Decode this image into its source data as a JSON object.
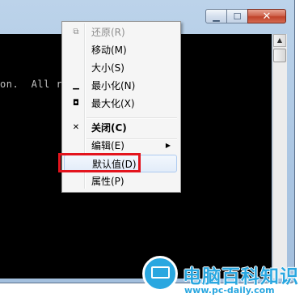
{
  "window": {
    "minimize_glyph": "▁",
    "maximize_glyph": "☐",
    "close_glyph": "✕"
  },
  "console": {
    "visible_text": "on.  All r"
  },
  "menu": {
    "items": [
      {
        "label": "还原(R)",
        "icon": "restore-icon",
        "glyph": "⧉",
        "disabled": true
      },
      {
        "label": "移动(M)",
        "icon": "",
        "glyph": "",
        "disabled": false
      },
      {
        "label": "大小(S)",
        "icon": "",
        "glyph": "",
        "disabled": false
      },
      {
        "label": "最小化(N)",
        "icon": "minimize-icon",
        "glyph": "▁",
        "disabled": false
      },
      {
        "label": "最大化(X)",
        "icon": "maximize-icon",
        "glyph": "◘",
        "disabled": false
      },
      {
        "label": "关闭(C)",
        "icon": "close-icon",
        "glyph": "✕",
        "disabled": false,
        "bold": true
      },
      {
        "label": "编辑(E)",
        "icon": "",
        "glyph": "",
        "disabled": false,
        "submenu": true,
        "submenu_glyph": "▶"
      },
      {
        "label": "默认值(D)",
        "icon": "",
        "glyph": "",
        "disabled": false,
        "hover": true
      },
      {
        "label": "属性(P)",
        "icon": "",
        "glyph": "",
        "disabled": false
      }
    ]
  },
  "watermark": {
    "title": "电脑百科知识",
    "url": "www.pc-daily.com"
  },
  "colors": {
    "highlight_border": "#e3141d",
    "watermark_accent": "#2aa7e0"
  }
}
